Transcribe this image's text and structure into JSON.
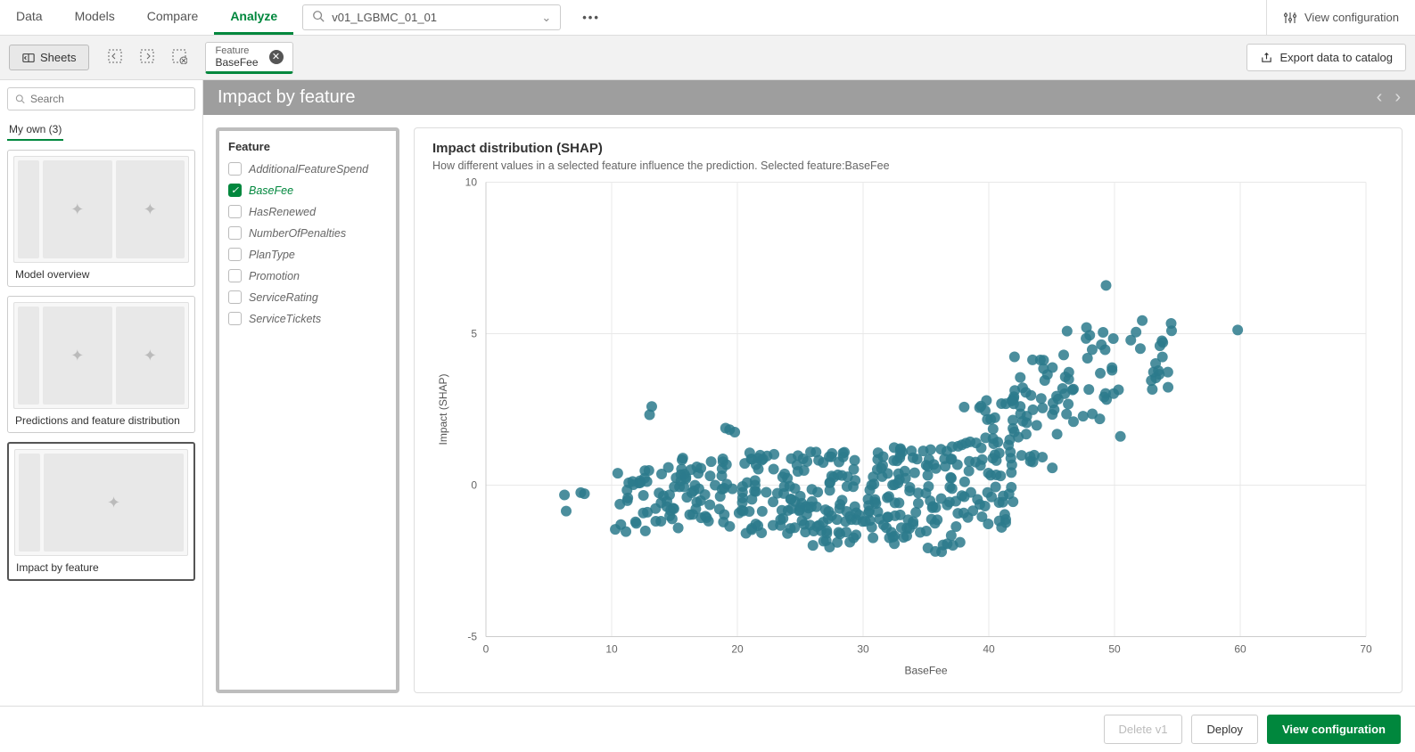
{
  "nav": {
    "tabs": [
      "Data",
      "Models",
      "Compare",
      "Analyze"
    ],
    "active": 3,
    "model": "v01_LGBMC_01_01",
    "viewConfig": "View configuration"
  },
  "toolbar": {
    "sheets": "Sheets",
    "chipLabel": "Feature",
    "chipValue": "BaseFee",
    "export": "Export data to catalog"
  },
  "sidebar": {
    "searchPlaceholder": "Search",
    "group": "My own (3)",
    "sheets": [
      {
        "title": "Model overview",
        "layout": "triple"
      },
      {
        "title": "Predictions and feature distribution",
        "layout": "triple"
      },
      {
        "title": "Impact by feature",
        "layout": "single",
        "selected": true
      }
    ]
  },
  "main": {
    "title": "Impact by feature",
    "featurePanelTitle": "Feature",
    "features": [
      {
        "name": "AdditionalFeatureSpend",
        "selected": false
      },
      {
        "name": "BaseFee",
        "selected": true
      },
      {
        "name": "HasRenewed",
        "selected": false
      },
      {
        "name": "NumberOfPenalties",
        "selected": false
      },
      {
        "name": "PlanType",
        "selected": false
      },
      {
        "name": "Promotion",
        "selected": false
      },
      {
        "name": "ServiceRating",
        "selected": false
      },
      {
        "name": "ServiceTickets",
        "selected": false
      }
    ],
    "chartTitle": "Impact distribution (SHAP)",
    "chartSubtitle": "How different values in a selected feature influence the prediction. Selected feature:BaseFee"
  },
  "footer": {
    "delete": "Delete v1",
    "deploy": "Deploy",
    "viewConfig": "View configuration"
  },
  "chart_data": {
    "type": "scatter",
    "xlabel": "BaseFee",
    "ylabel": "Impact (SHAP)",
    "xlim": [
      0,
      70
    ],
    "ylim": [
      -5,
      10
    ],
    "xticks": [
      0,
      10,
      20,
      30,
      40,
      50,
      60,
      70
    ],
    "yticks": [
      -5,
      0,
      5,
      10
    ],
    "note": "Approximate point cloud estimated from image. Dense cluster x≈10–42 y≈-2 to 1.5; rising trend x≈40–55 y up to ~6.5; outlier near x≈60 y≈5.3.",
    "bands": [
      {
        "xmin": 4,
        "xmax": 8,
        "ymin": -0.9,
        "ymax": -0.1,
        "n": 4
      },
      {
        "xmin": 10,
        "xmax": 14,
        "ymin": -1.6,
        "ymax": 0.6,
        "n": 30
      },
      {
        "xmin": 13,
        "xmax": 14,
        "ymin": 2.3,
        "ymax": 2.9,
        "n": 2
      },
      {
        "xmin": 14,
        "xmax": 20,
        "ymin": -1.5,
        "ymax": 1.0,
        "n": 60
      },
      {
        "xmin": 19,
        "xmax": 20,
        "ymin": 1.2,
        "ymax": 1.9,
        "n": 3
      },
      {
        "xmin": 20,
        "xmax": 26,
        "ymin": -1.6,
        "ymax": 1.1,
        "n": 80
      },
      {
        "xmin": 26,
        "xmax": 32,
        "ymin": -2.1,
        "ymax": 1.2,
        "n": 90
      },
      {
        "xmin": 32,
        "xmax": 38,
        "ymin": -2.2,
        "ymax": 1.4,
        "n": 90
      },
      {
        "xmin": 38,
        "xmax": 42,
        "ymin": -1.4,
        "ymax": 3.0,
        "n": 70
      },
      {
        "xmin": 42,
        "xmax": 46,
        "ymin": 0.5,
        "ymax": 4.4,
        "n": 40
      },
      {
        "xmin": 46,
        "xmax": 50,
        "ymin": 2.0,
        "ymax": 5.3,
        "n": 30
      },
      {
        "xmin": 49,
        "xmax": 50,
        "ymin": 6.2,
        "ymax": 6.7,
        "n": 1
      },
      {
        "xmin": 50,
        "xmax": 55,
        "ymin": 3.0,
        "ymax": 5.5,
        "n": 20
      },
      {
        "xmin": 50,
        "xmax": 51,
        "ymin": 1.6,
        "ymax": 2.0,
        "n": 1
      },
      {
        "xmin": 59,
        "xmax": 60,
        "ymin": 5.1,
        "ymax": 5.4,
        "n": 1
      }
    ]
  }
}
